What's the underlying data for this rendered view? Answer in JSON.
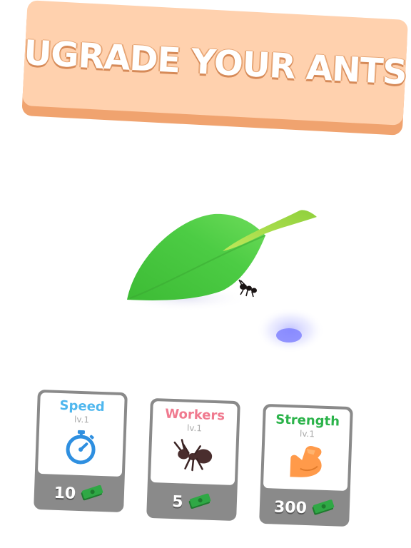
{
  "banner": {
    "title": "UGRADE YOUR ANTS"
  },
  "colors": {
    "speed": "#4fb7ee",
    "workers": "#f07a8f",
    "strength": "#2bb34a",
    "banner_bg": "#ffd1ae",
    "banner_shadow": "#f0a36f",
    "leaf": "#45c43f",
    "card_frame": "#8a8a8a"
  },
  "upgrades": [
    {
      "name": "Speed",
      "level": "lv.1",
      "price": "10",
      "icon": "stopwatch-icon"
    },
    {
      "name": "Workers",
      "level": "lv.1",
      "price": "5",
      "icon": "ant-icon"
    },
    {
      "name": "Strength",
      "level": "lv.1",
      "price": "300",
      "icon": "flexed-arm-icon"
    }
  ],
  "currency_icon": "cash-icon"
}
